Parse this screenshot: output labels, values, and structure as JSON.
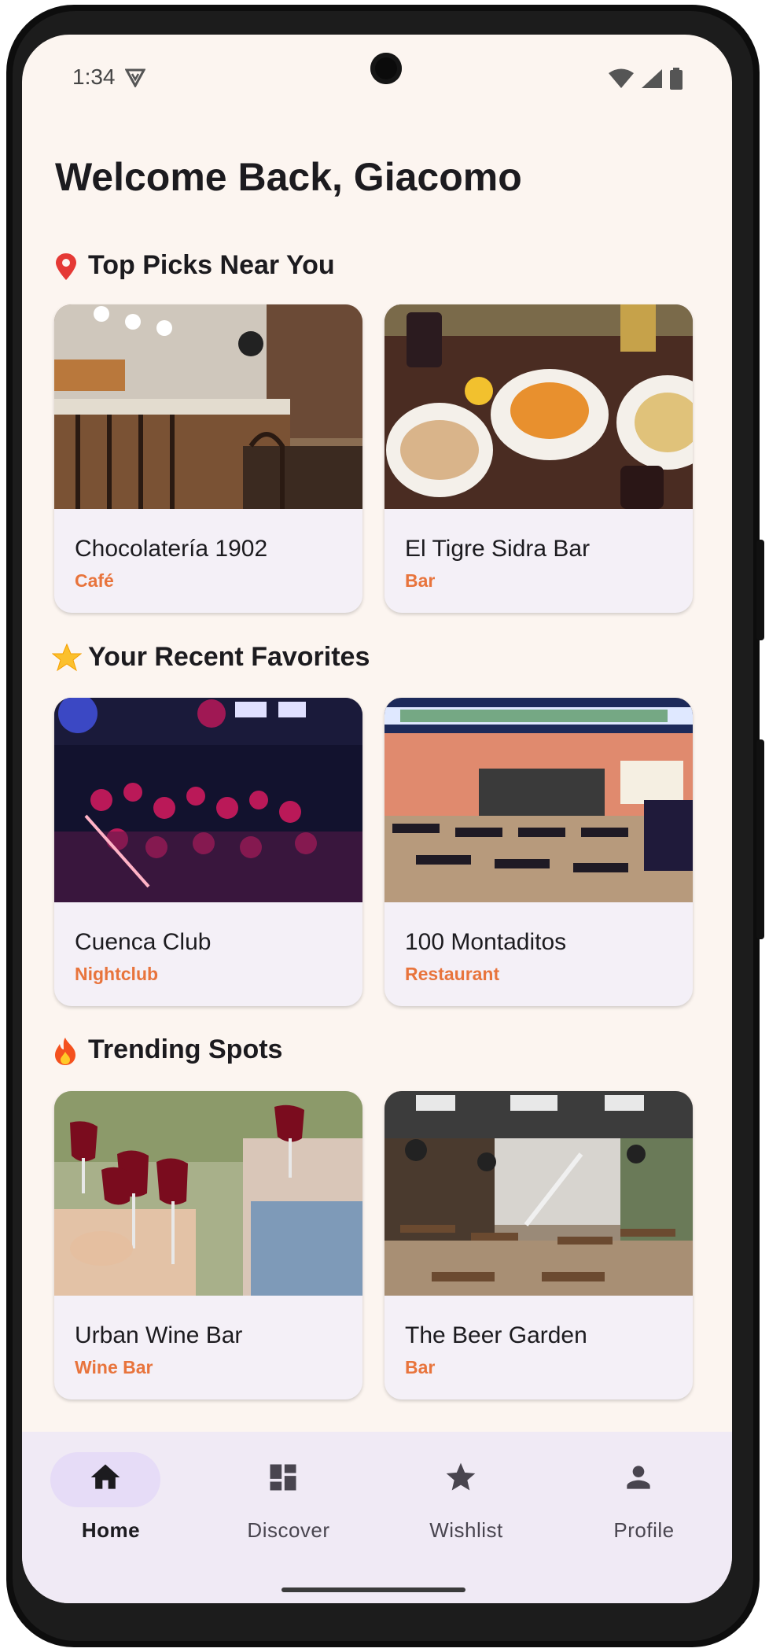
{
  "status_bar": {
    "time": "1:34"
  },
  "header": {
    "title": "Welcome Back, Giacomo"
  },
  "sections": [
    {
      "title": "Top Picks Near You",
      "icon": "pin-icon",
      "cards": [
        {
          "name": "Chocolatería 1902",
          "category": "Café"
        },
        {
          "name": "El Tigre Sidra Bar",
          "category": "Bar"
        }
      ]
    },
    {
      "title": "Your Recent Favorites",
      "icon": "star-emoji-icon",
      "cards": [
        {
          "name": "Cuenca Club",
          "category": "Nightclub"
        },
        {
          "name": "100 Montaditos",
          "category": "Restaurant"
        }
      ]
    },
    {
      "title": "Trending Spots",
      "icon": "fire-icon",
      "cards": [
        {
          "name": "Urban Wine Bar",
          "category": "Wine Bar"
        },
        {
          "name": "The Beer Garden",
          "category": "Bar"
        }
      ]
    }
  ],
  "bottom_nav": {
    "items": [
      {
        "label": "Home",
        "icon": "home-icon",
        "active": true
      },
      {
        "label": "Discover",
        "icon": "dashboard-icon",
        "active": false
      },
      {
        "label": "Wishlist",
        "icon": "star-icon",
        "active": false
      },
      {
        "label": "Profile",
        "icon": "person-icon",
        "active": false
      }
    ]
  },
  "colors": {
    "background": "#fcf5f0",
    "card": "#f4f0f7",
    "category": "#e8743c",
    "nav_bg": "#f0eaf5",
    "nav_active_pill": "#e6dcf7"
  }
}
